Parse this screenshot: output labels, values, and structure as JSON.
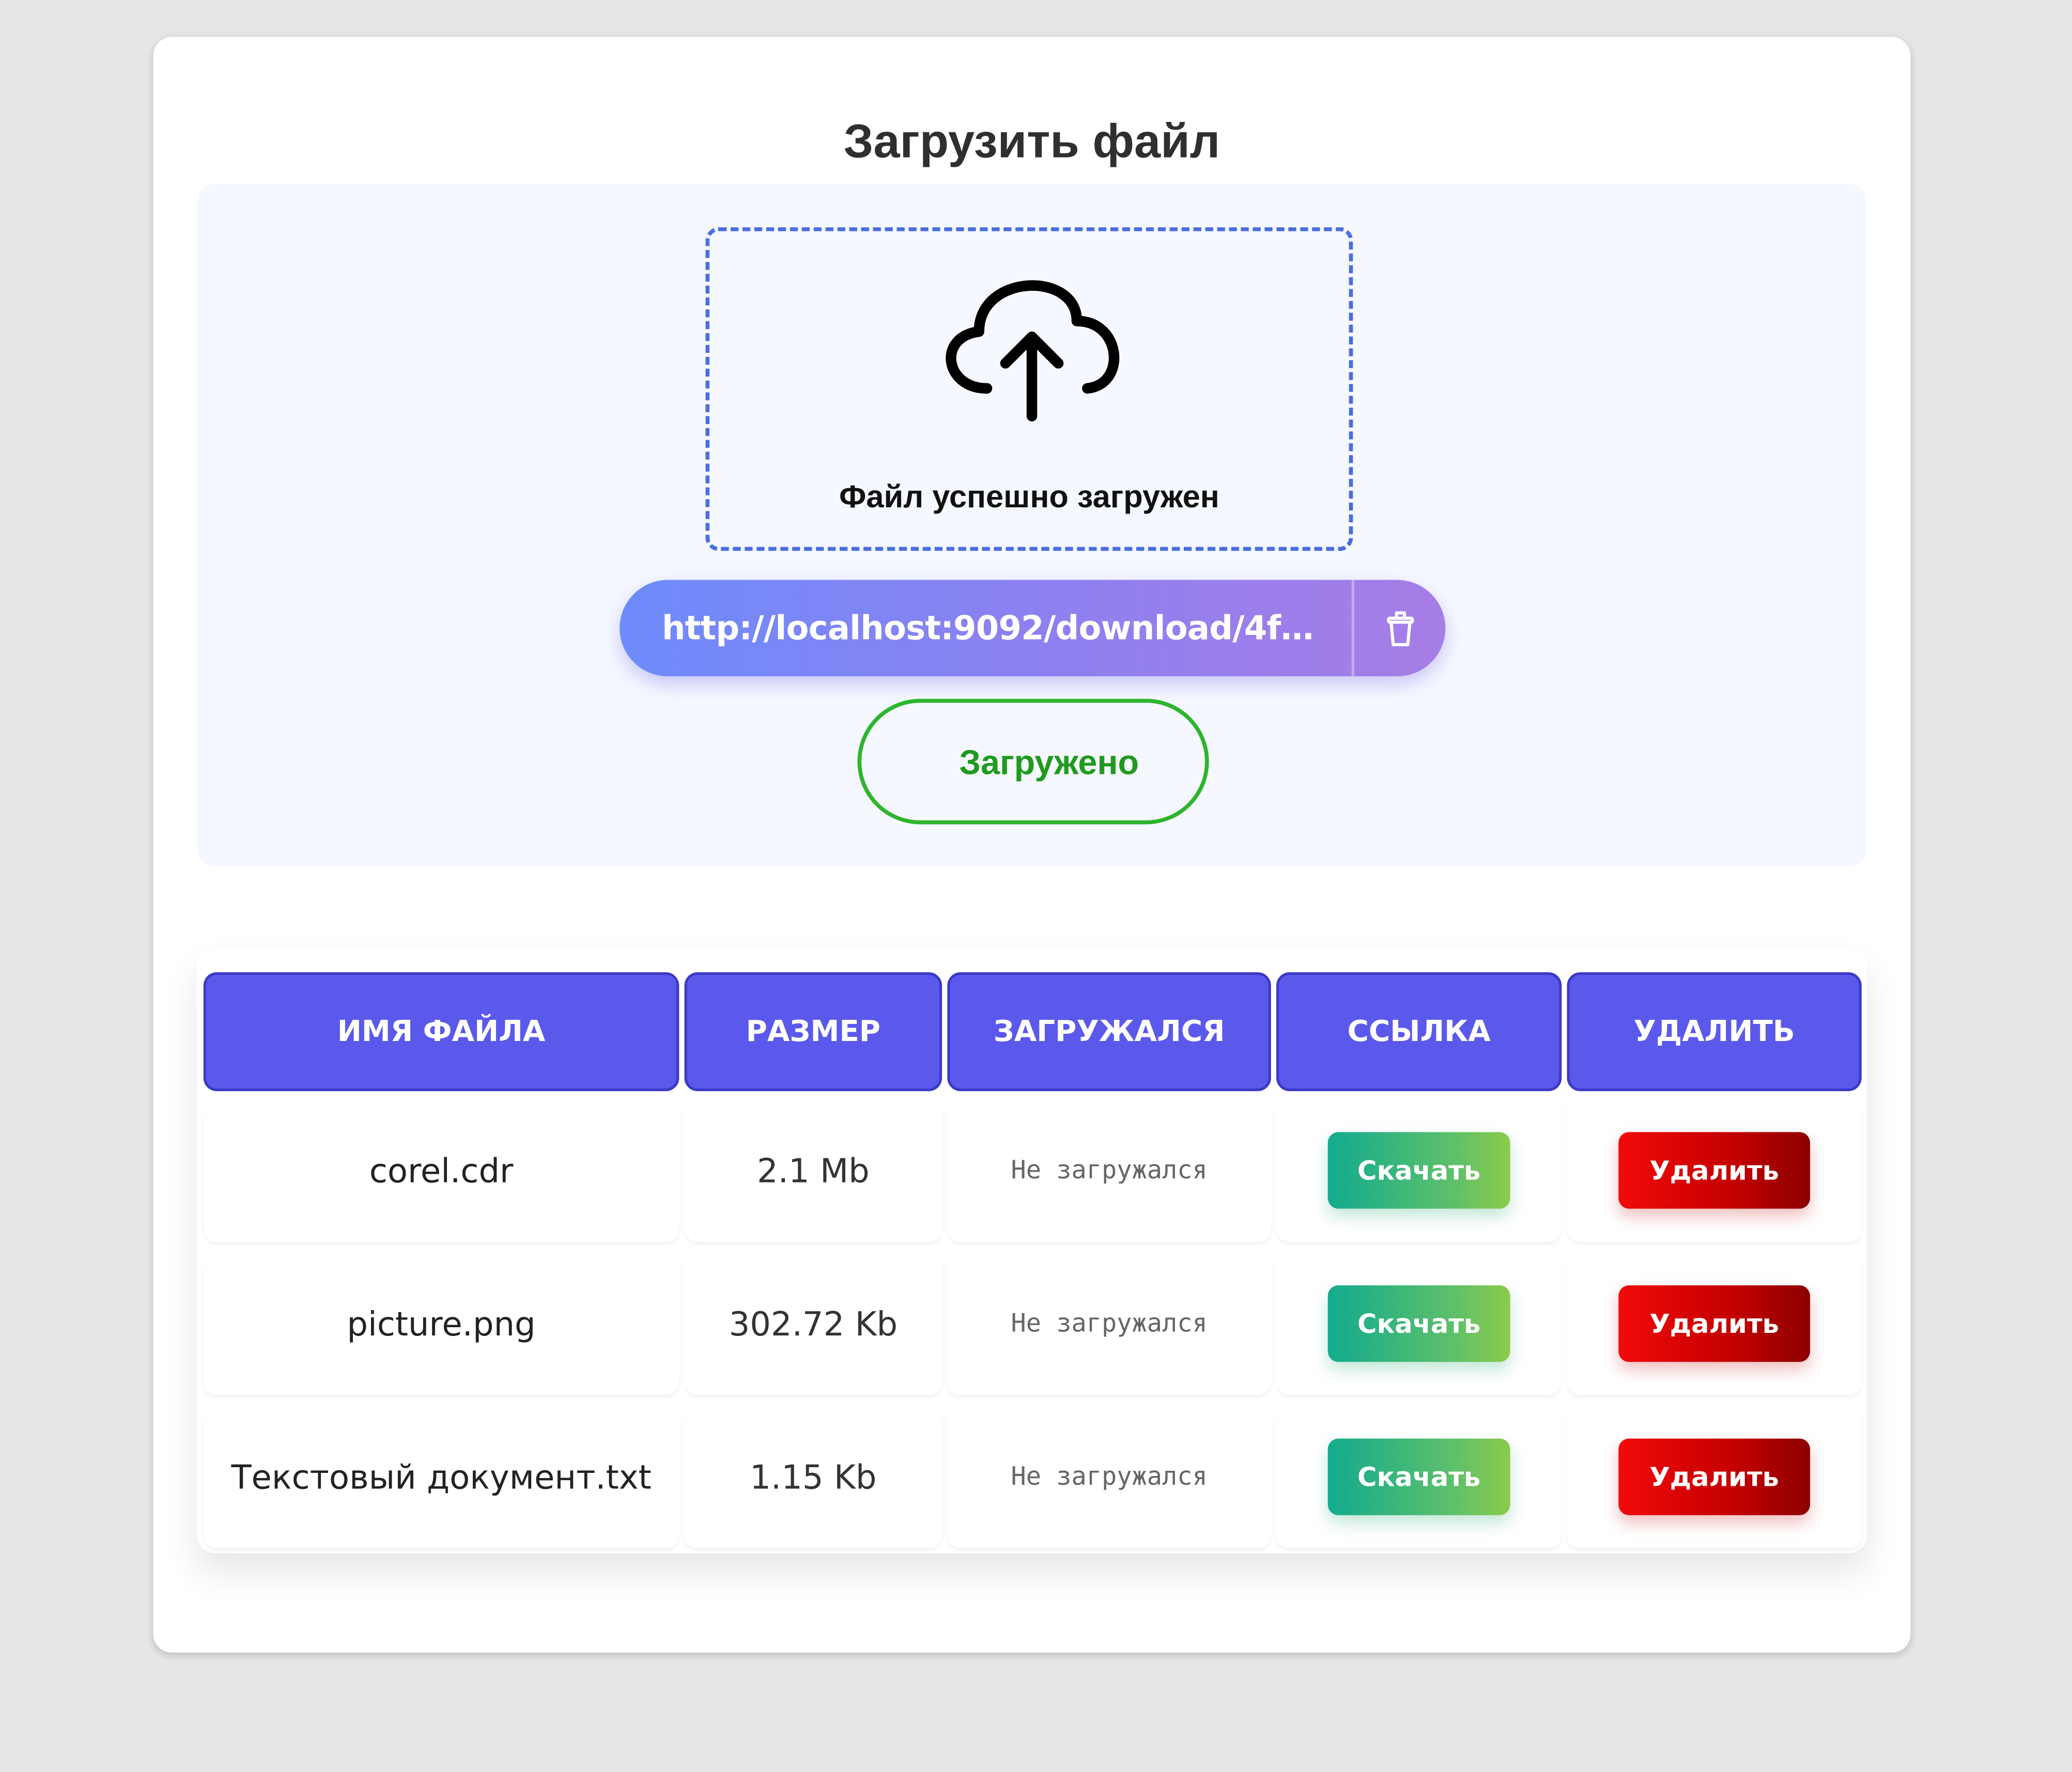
{
  "colors": {
    "page_bg": "#e6e6e6",
    "card_bg": "#ffffff",
    "header_accent": "#5b59eb",
    "success_green": "#2db52d",
    "download_gradient_start": "#12ab8e",
    "download_gradient_end": "#8ccb48",
    "delete_gradient_start": "#f20a0a",
    "delete_gradient_end": "#8c0000",
    "link_gradient_start": "#6e8bfb",
    "link_gradient_end": "#a77de6"
  },
  "page": {
    "title": "Загрузить файл"
  },
  "upload": {
    "icon": "cloud-upload-icon",
    "status_text": "Файл успешно загружен",
    "link_text": "http://localhost:9092/download/4fc24...",
    "link_icon": "trash-icon",
    "state_label": "Загружено"
  },
  "table": {
    "headers": [
      "Имя файла",
      "Размер",
      "Загружался",
      "Ссылка",
      "Удалить"
    ],
    "rows": [
      {
        "name": "corel.cdr",
        "size": "2.1 Mb",
        "downloaded": "Не загружался",
        "download_label": "Скачать",
        "delete_label": "Удалить"
      },
      {
        "name": "picture.png",
        "size": "302.72 Kb",
        "downloaded": "Не загружался",
        "download_label": "Скачать",
        "delete_label": "Удалить"
      },
      {
        "name": "Текстовый документ.txt",
        "size": "1.15 Kb",
        "downloaded": "Не загружался",
        "download_label": "Скачать",
        "delete_label": "Удалить"
      }
    ]
  }
}
